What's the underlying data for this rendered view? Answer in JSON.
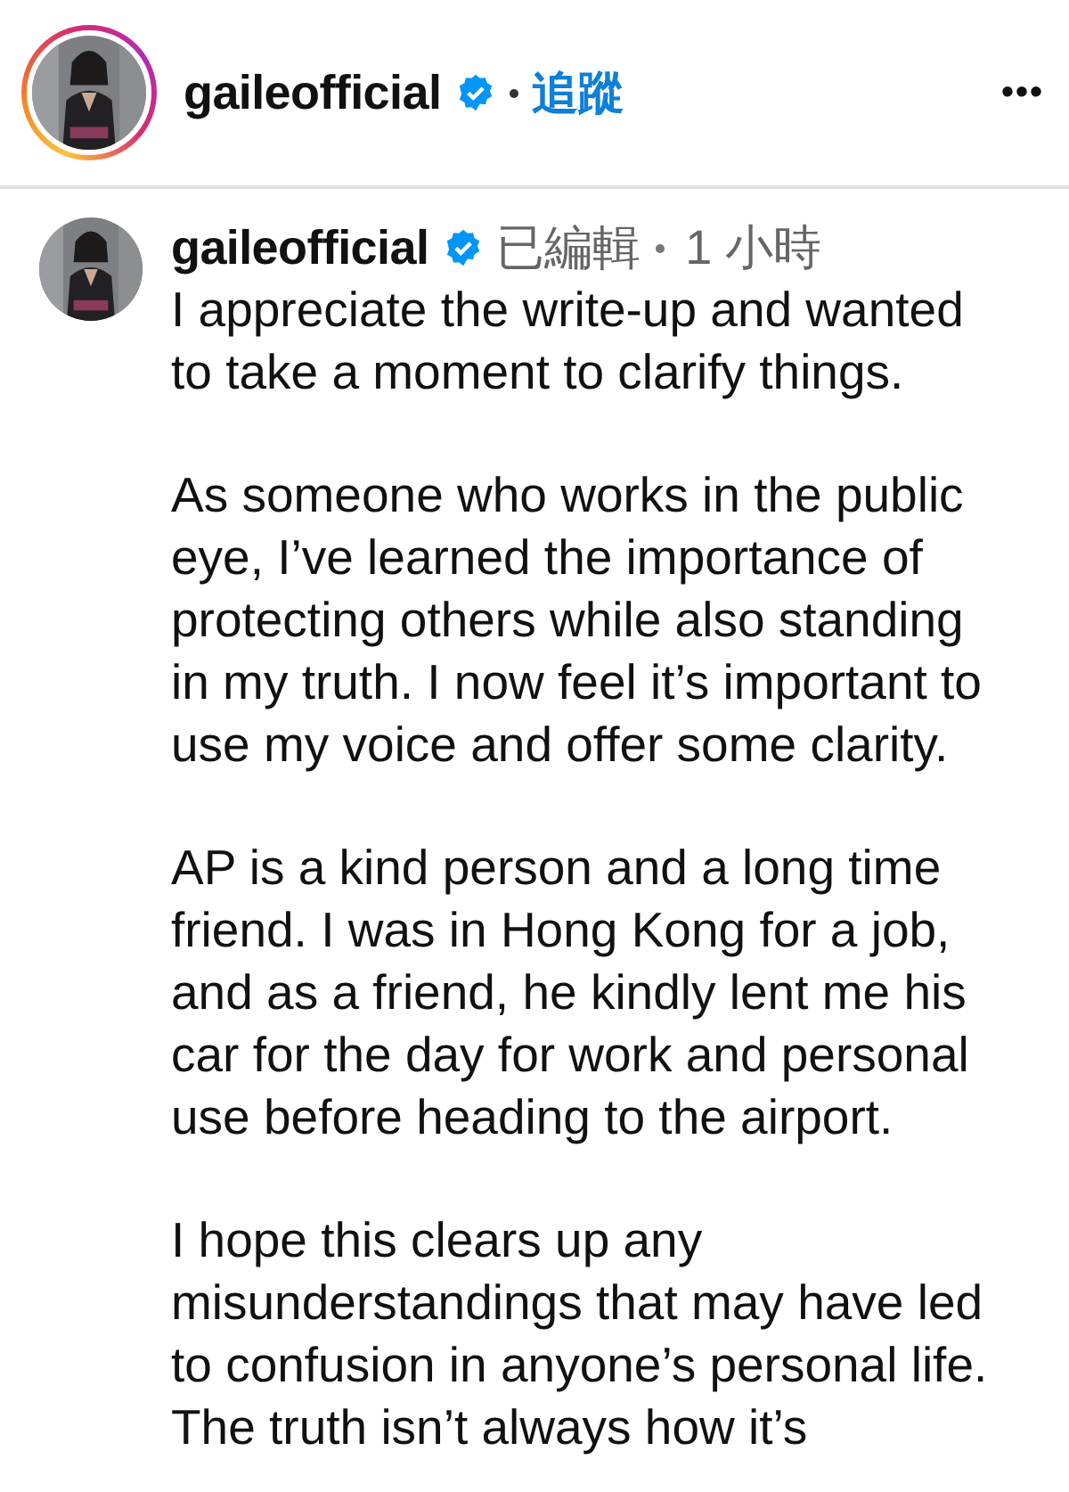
{
  "header": {
    "username": "gaileofficial",
    "verified": true,
    "follow_label": "追蹤",
    "more_label": "•••"
  },
  "comment": {
    "username": "gaileofficial",
    "verified": true,
    "edited_label": "已編輯",
    "time": "1 小時",
    "paragraphs": [
      "I appreciate the write-up and wanted\nto take a moment to clarify things.",
      "As someone who works in the public\neye, I’ve learned the importance of\nprotecting others while also standing\nin my truth. I now feel it’s important to\nuse my voice and offer some clarity.",
      "AP is a kind person and a long time\nfriend. I was in Hong Kong for a job,\nand as a friend, he kindly lent me his\ncar for the day for work and personal\nuse before heading to the airport.",
      "I hope this clears up any\nmisunderstandings that may have led\nto confusion in anyone’s personal life.\nThe truth isn’t always how it’s"
    ]
  }
}
